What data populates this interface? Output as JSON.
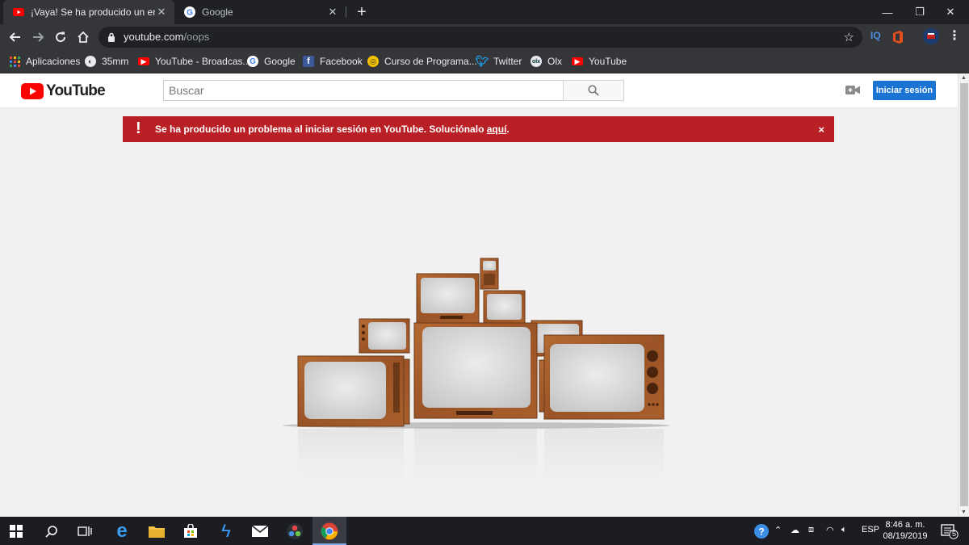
{
  "browser": {
    "tabs": [
      {
        "title": "¡Vaya! Se ha producido un error",
        "active": true
      },
      {
        "title": "Google",
        "active": false
      }
    ],
    "url_domain": "youtube.com",
    "url_path": "/oops",
    "extensions": [
      "IQ"
    ],
    "bookmarks": [
      {
        "label": "Aplicaciones",
        "icon": "apps-grid-icon"
      },
      {
        "label": "35mm",
        "icon": "globe-icon"
      },
      {
        "label": "YouTube - Broadcas...",
        "icon": "youtube-icon"
      },
      {
        "label": "Google",
        "icon": "google-icon"
      },
      {
        "label": "Facebook",
        "icon": "facebook-icon"
      },
      {
        "label": "Curso de Programa...",
        "icon": "course-icon"
      },
      {
        "label": "Twitter",
        "icon": "twitter-icon"
      },
      {
        "label": "Olx",
        "icon": "olx-icon"
      },
      {
        "label": "YouTube",
        "icon": "youtube-icon"
      }
    ]
  },
  "youtube": {
    "logo_text": "YouTube",
    "search_placeholder": "Buscar",
    "signin_label": "Iniciar sesión",
    "alert": {
      "message": "Se ha producido un problema al iniciar sesión en YouTube. Soluciónalo ",
      "link": "aquí",
      "suffix": ".",
      "close": "×"
    }
  },
  "taskbar": {
    "language": "ESP",
    "time": "8:46 a. m.",
    "date": "08/19/2019",
    "notifications": "5"
  },
  "colors": {
    "yt_red": "#ff0000",
    "alert_red": "#b92025",
    "signin_blue": "#1b74d3",
    "tv_wood": "#a0582a"
  }
}
